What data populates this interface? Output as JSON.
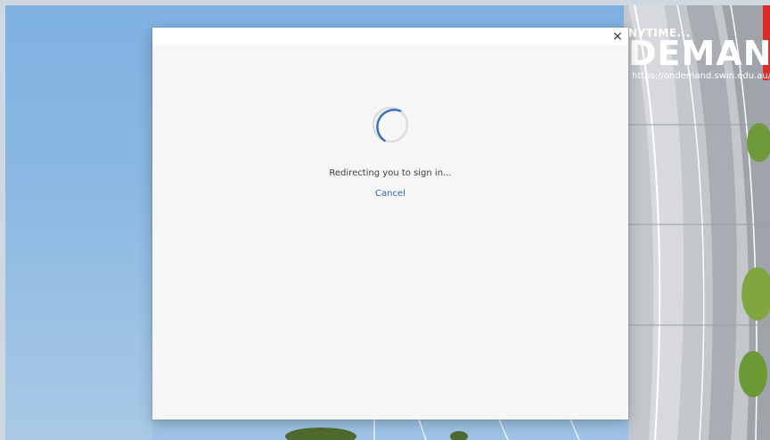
{
  "background": {
    "banner": {
      "tagline": "NYTIME...",
      "title": "DEMAND",
      "url": "https://ondemand.swin.edu.au/"
    },
    "colors": {
      "sky": "#7fb1e2",
      "facade": "#b9bdc2",
      "accent_red": "#e02a28"
    }
  },
  "dialog": {
    "close_icon": "close-icon",
    "close_glyph": "×",
    "status": "Redirecting you to sign in...",
    "cancel_label": "Cancel",
    "spinner_icon": "loading-spinner-icon",
    "colors": {
      "link": "#2f5fc0",
      "spinner": "#3a6fc4",
      "panel": "#f5f6f5"
    }
  }
}
